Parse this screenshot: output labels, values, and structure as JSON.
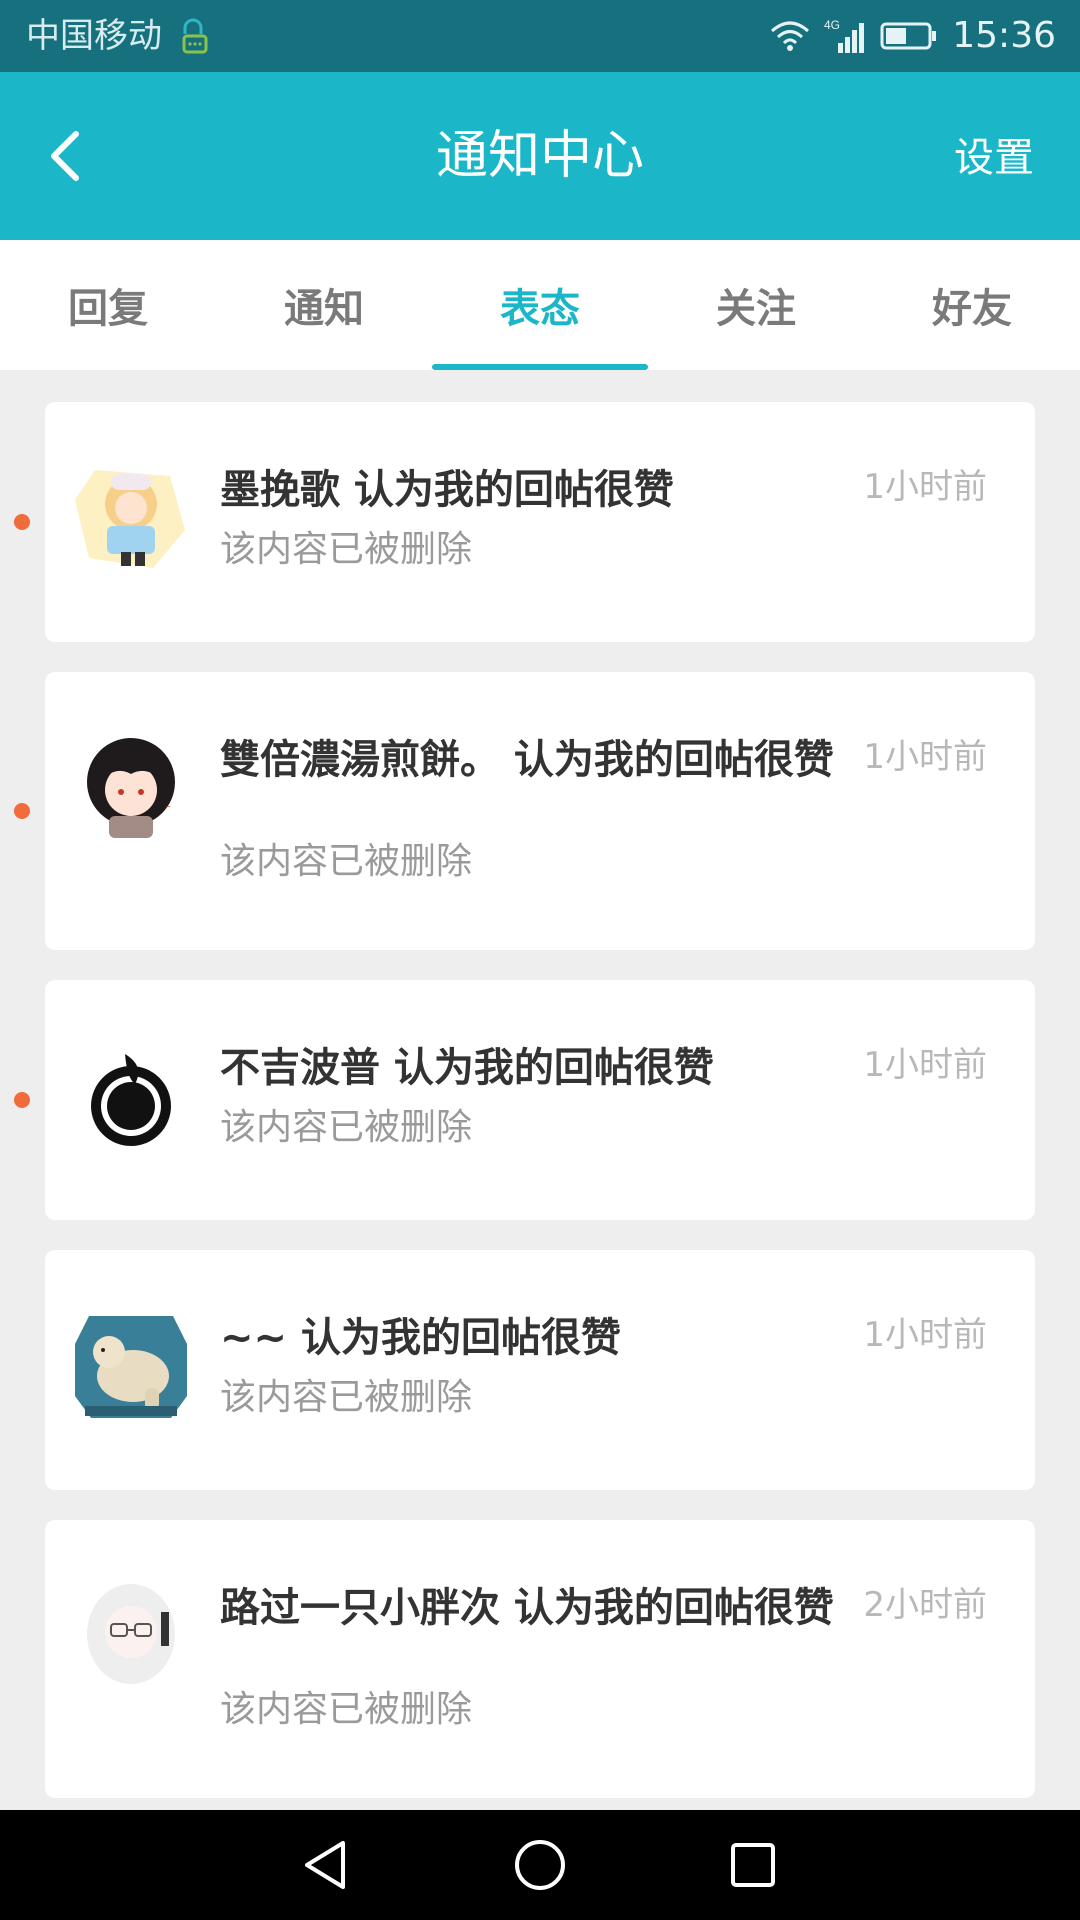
{
  "status_bar": {
    "carrier": "中国移动",
    "network": "4G",
    "time": "15:36"
  },
  "header": {
    "title": "通知中心",
    "settings_label": "设置",
    "accent_color": "#1bb7c8"
  },
  "tabs": [
    {
      "label": "回复",
      "active": false
    },
    {
      "label": "通知",
      "active": false
    },
    {
      "label": "表态",
      "active": true
    },
    {
      "label": "关注",
      "active": false
    },
    {
      "label": "好友",
      "active": false
    }
  ],
  "notifications": [
    {
      "title": "墨挽歌 认为我的回帖很赞",
      "subtitle": "该内容已被删除",
      "time": "1小时前",
      "unread": true,
      "avatar": "anime-girl-avatar"
    },
    {
      "title": "雙倍濃湯煎餅。 认为我的回帖很赞",
      "subtitle": "该内容已被删除",
      "time": "1小时前",
      "unread": true,
      "avatar": "anime-boy-avatar"
    },
    {
      "title": "不吉波普 认为我的回帖很赞",
      "subtitle": "该内容已被删除",
      "time": "1小时前",
      "unread": true,
      "avatar": "black-logo-avatar"
    },
    {
      "title": "~~ 认为我的回帖很赞",
      "subtitle": "该内容已被删除",
      "time": "1小时前",
      "unread": false,
      "avatar": "polar-bear-avatar"
    },
    {
      "title": "路过一只小胖次 认为我的回帖很赞",
      "subtitle": "该内容已被删除",
      "time": "2小时前",
      "unread": false,
      "avatar": "white-hair-girl-avatar"
    }
  ]
}
